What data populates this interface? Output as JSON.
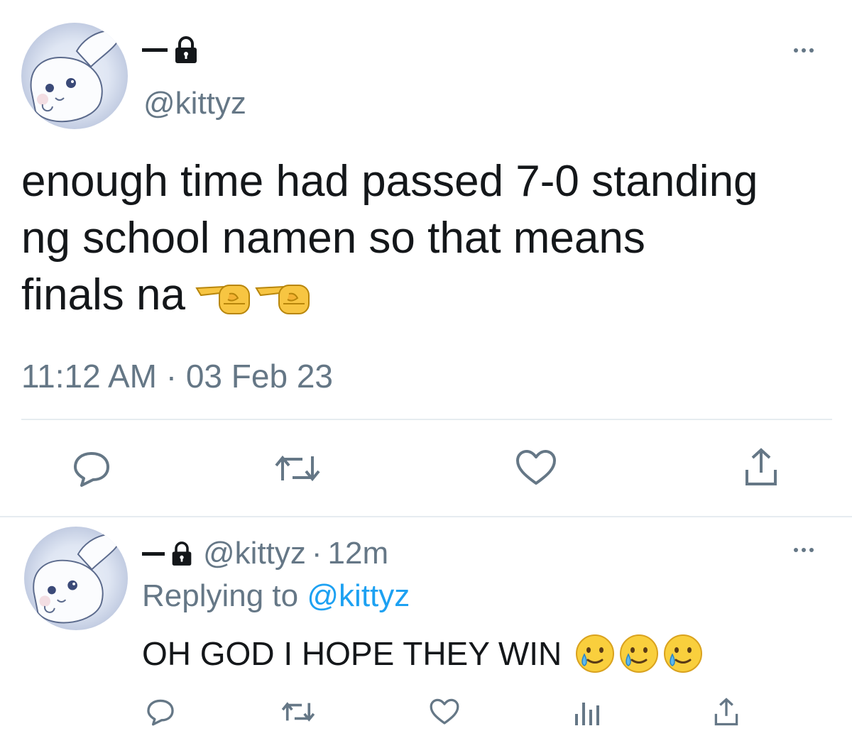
{
  "main_tweet": {
    "display_name": "—",
    "handle": "@kittyz",
    "body": "enough time had passed 7-0 standing ng school namen so that means finals na",
    "body_line1": "enough time had passed 7-0 standing",
    "body_line2": "ng school namen so that means",
    "body_line3": "finals na",
    "emoji": [
      "fist-bump-icon",
      "fist-bump-icon"
    ],
    "time": "11:12 AM",
    "separator": "·",
    "date": "03 Feb 23"
  },
  "reply_tweet": {
    "display_name": "—",
    "handle": "@kittyz",
    "separator": "·",
    "age": "12m",
    "replying_prefix": "Replying to",
    "replying_handle": "@kittyz",
    "body": "OH GOD I HOPE THEY WIN",
    "emoji": [
      "smiling-face-with-tear-icon",
      "smiling-face-with-tear-icon",
      "smiling-face-with-tear-icon"
    ]
  },
  "actions_main": [
    "reply-icon",
    "retweet-icon",
    "like-icon",
    "share-icon"
  ],
  "actions_reply": [
    "reply-icon",
    "retweet-icon",
    "like-icon",
    "analytics-icon",
    "share-icon"
  ],
  "colors": {
    "text": "#14171a",
    "muted": "#657786",
    "link": "#1da1f2",
    "divider": "#e6ecf0"
  }
}
